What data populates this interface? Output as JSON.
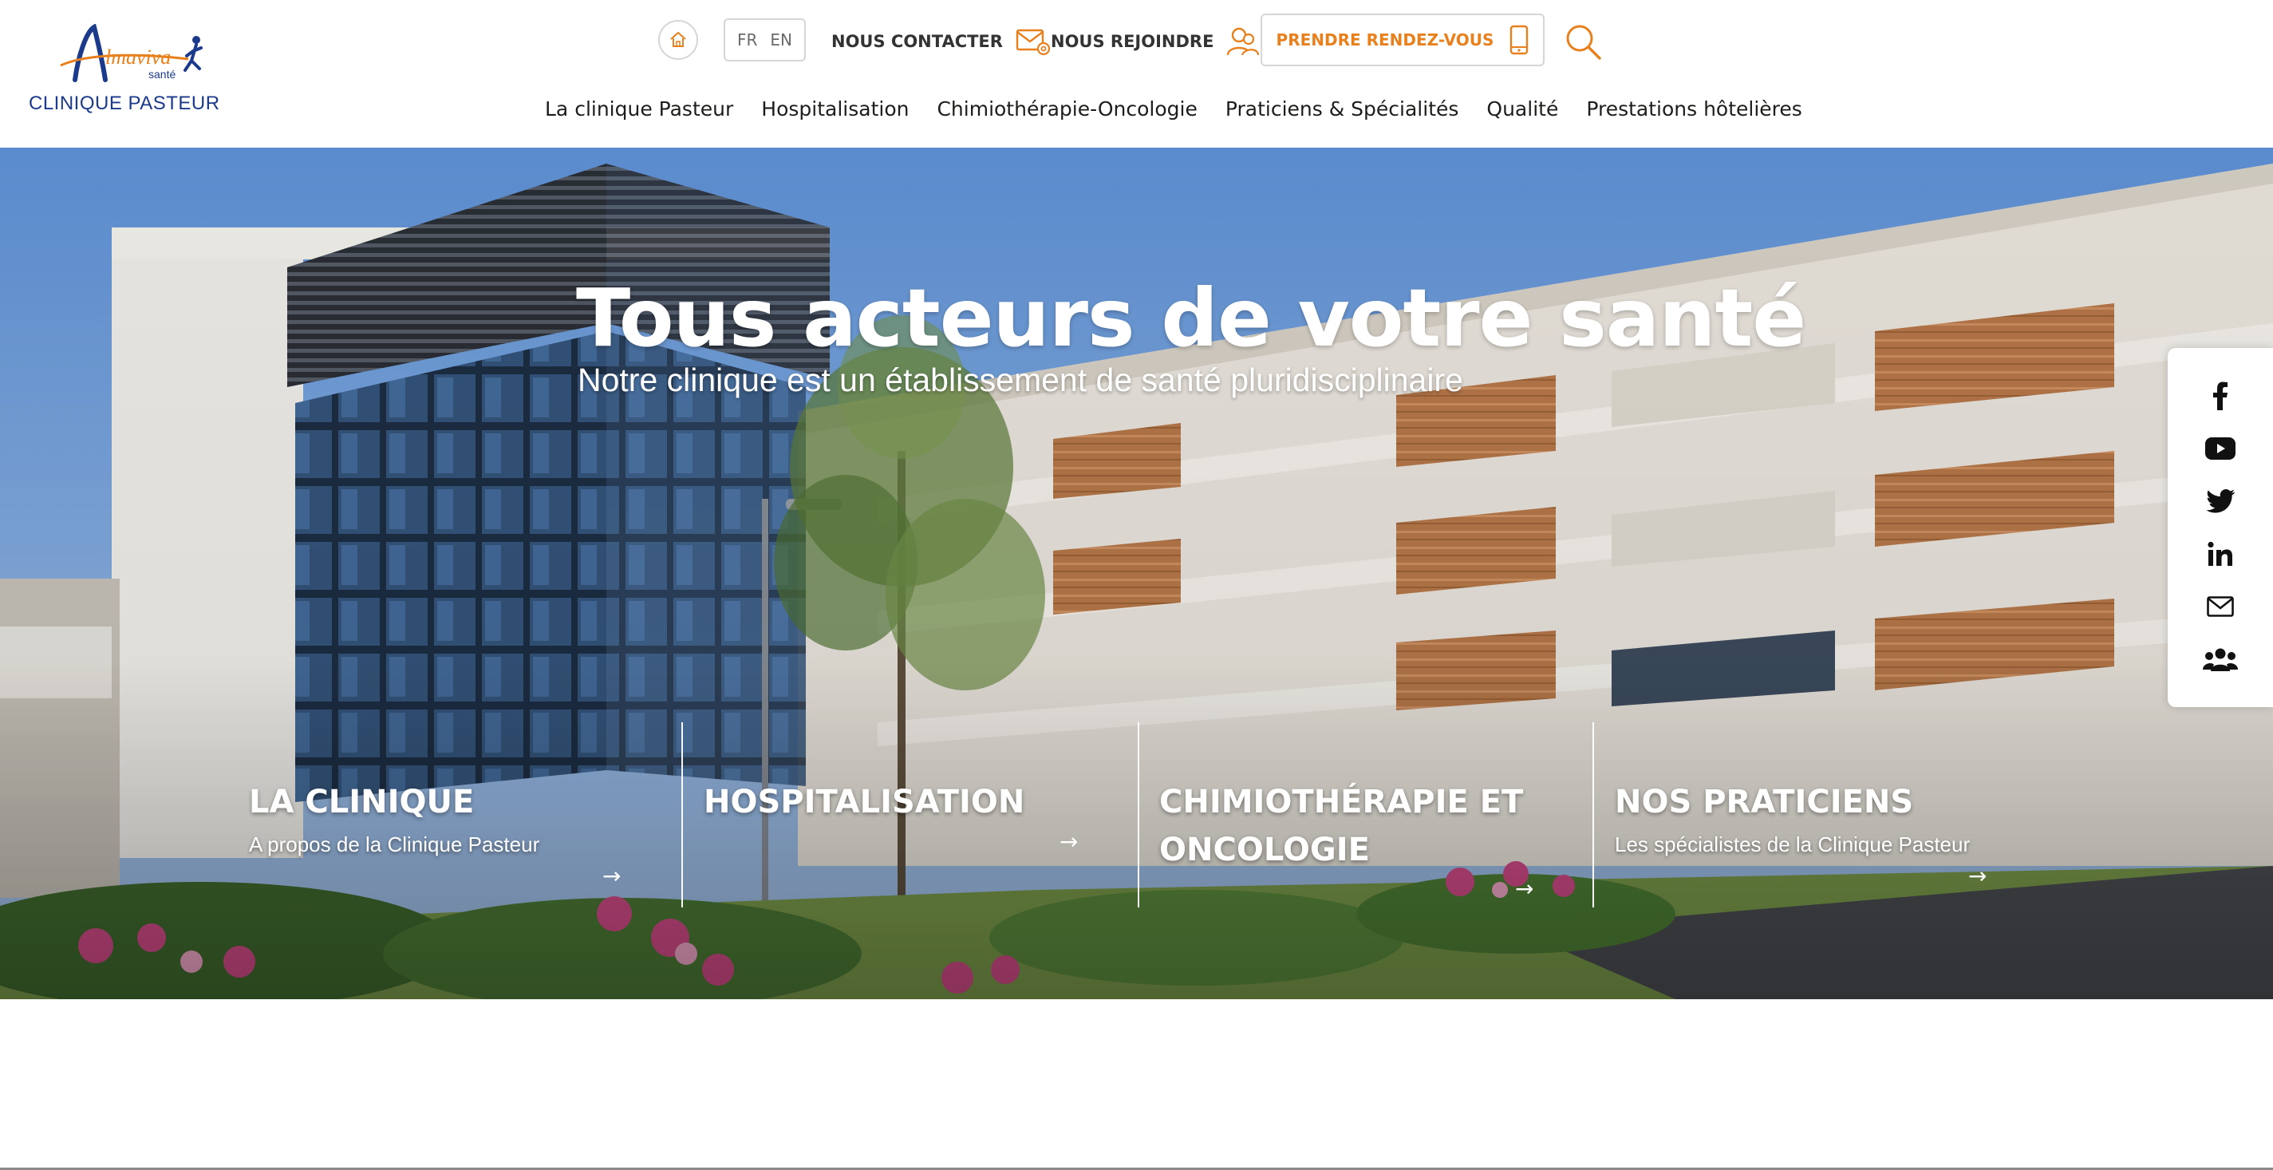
{
  "brand": {
    "logo_text": "Almaviva",
    "logo_sub": "santé",
    "clinic_name": "CLINIQUE PASTEUR"
  },
  "header": {
    "languages": [
      "FR",
      "EN"
    ],
    "contact_label": "NOUS CONTACTER",
    "join_label": "NOUS REJOINDRE",
    "appointment_label": "PRENDRE RENDEZ-VOUS"
  },
  "nav": [
    {
      "label": "La clinique Pasteur"
    },
    {
      "label": "Hospitalisation"
    },
    {
      "label": "Chimiothérapie-Oncologie"
    },
    {
      "label": "Praticiens & Spécialités"
    },
    {
      "label": "Qualité"
    },
    {
      "label": "Prestations hôtelières"
    }
  ],
  "hero": {
    "title": "Tous acteurs de votre santé",
    "subtitle": "Notre clinique est un établissement de santé pluridisciplinaire"
  },
  "cards": [
    {
      "title": "LA CLINIQUE",
      "title2": "",
      "subtitle": "A propos de la Clinique Pasteur"
    },
    {
      "title": "HOSPITALISATION",
      "title2": "",
      "subtitle": ""
    },
    {
      "title": "CHIMIOTHÉRAPIE ET",
      "title2": "ONCOLOGIE",
      "subtitle": ""
    },
    {
      "title": "NOS PRATICIENS",
      "title2": "",
      "subtitle": "Les spécialistes de la Clinique Pasteur"
    }
  ],
  "social": [
    "facebook-icon",
    "youtube-icon",
    "twitter-icon",
    "linkedin-icon",
    "mail-icon",
    "group-icon"
  ],
  "colors": {
    "accent_orange": "#e8801e",
    "brand_blue": "#1b3a8c",
    "nav_text": "#1d1d1b"
  }
}
